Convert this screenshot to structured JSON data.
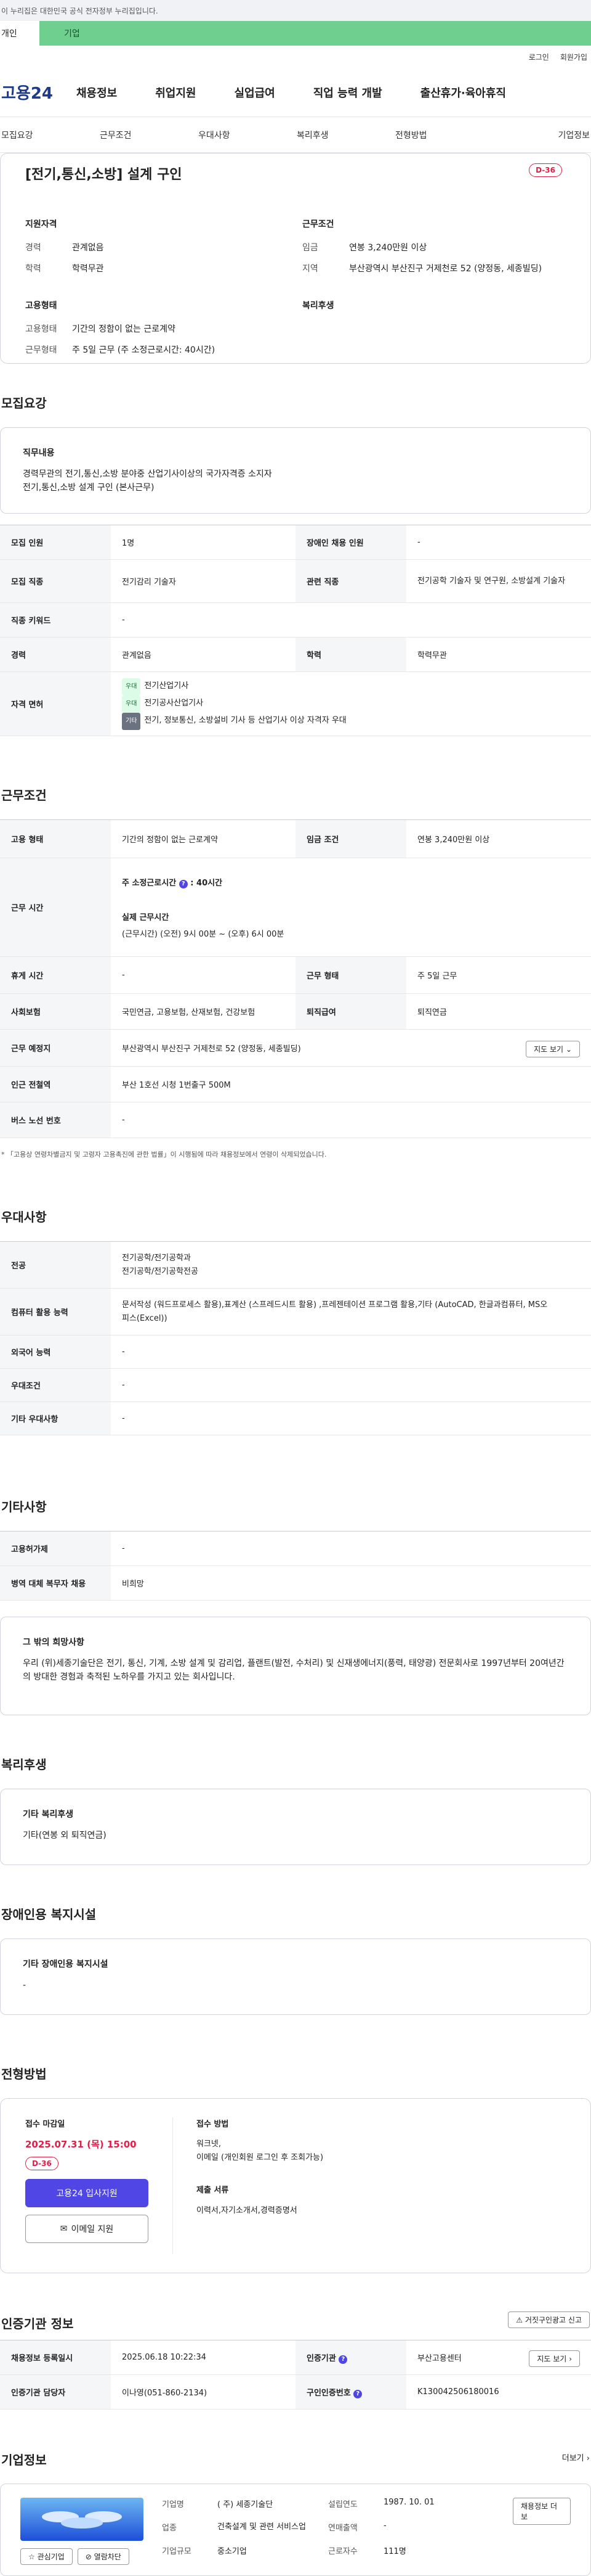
{
  "gov_banner": "이 누리집은 대한민국 공식 전자정부 누리집입니다.",
  "site_tabs": [
    "개인",
    "기업"
  ],
  "util": [
    "로그인",
    "회원가입"
  ],
  "logo": "고용24",
  "gnb": [
    "채용정보",
    "취업지원",
    "실업급여",
    "직업 능력 개발",
    "출산휴가·육아휴직"
  ],
  "subnav": [
    "모집요강",
    "근무조건",
    "우대사항",
    "복리후생",
    "전형방법",
    "기업정보"
  ],
  "hero": {
    "title": "[전기,통신,소방] 설계 구인",
    "dday": "D-36",
    "qual_title": "지원자격",
    "career_k": "경력",
    "career_v": "관계없음",
    "edu_k": "학력",
    "edu_v": "학력무관",
    "cond_title": "근무조건",
    "wage_k": "임금",
    "wage_v": "연봉 3,240만원 이상",
    "area_k": "지역",
    "area_v": "부산광역시 부산진구 거제천로 52 (양정동, 세종빌딩)",
    "emp_title": "고용형태",
    "emp_type_k": "고용형태",
    "emp_type_v": "기간의 정함이 없는 근로계약",
    "work_k": "근무형태",
    "work_v": "주 5일 근무 (주 소정근로시간: 40시간)",
    "welfare_title": "복리후생"
  },
  "recruit": {
    "title": "모집요강",
    "duty_title": "직무내용",
    "duty_lines": [
      "경력무관의 전기,통신,소방 분야중 산업기사이상의 국가자격증 소지자",
      "전기,통신,소방 설계 구인 (본사근무)"
    ],
    "rows": [
      {
        "k": "모집 인원",
        "v": "1명",
        "k2": "장애인 채용 인원",
        "v2": "-"
      },
      {
        "k": "모집 직종",
        "v": "전기감리 기술자",
        "k2": "관련 직종",
        "v2": "전기공학 기술자 및 연구원, 소방설계 기술자"
      },
      {
        "k": "직종 키워드",
        "v": "-"
      },
      {
        "k": "경력",
        "v": "관계없음",
        "k2": "학력",
        "v2": "학력무관"
      }
    ],
    "license_k": "자격 면허",
    "licenses": [
      {
        "tag": "우대",
        "name": "전기산업기사"
      },
      {
        "tag": "우대",
        "name": "전기공사산업기사"
      },
      {
        "tag": "기타",
        "name": "전기, 정보통신, 소방설비 기사 등 산업기사 이상 자격자 우대"
      }
    ]
  },
  "conditions": {
    "title": "근무조건",
    "emp_k": "고용 형태",
    "emp_v": "기간의 정함이 없는 근로계약",
    "wage_k": "임금 조건",
    "wage_v": "연봉 3,240만원 이상",
    "time_k": "근무 시간",
    "time_t1": "주 소정근로시간",
    "time_v1": "40시간",
    "time_t2": "실제 근무시간",
    "time_v2": "(근무시간) (오전) 9시 00분 ~ (오후) 6시 00분",
    "rest_k": "휴게 시간",
    "rest_v": "-",
    "type_k": "근무 형태",
    "type_v": "주 5일 근무",
    "ins_k": "사회보험",
    "ins_v": "국민연금, 고용보험, 산재보험, 건강보험",
    "ret_k": "퇴직급여",
    "ret_v": "퇴직연금",
    "place_k": "근무 예정지",
    "place_v": "부산광역시 부산진구 거제천로 52 (양정동, 세종빌딩)",
    "map_btn": "지도 보기",
    "sub_k": "인근 전철역",
    "sub_v": "부산 1호선 시청 1번출구 500M",
    "bus_k": "버스 노선 번호",
    "bus_v": "-",
    "note": "「고용상 연령차별금지 및 고령자 고용촉진에 관한 법률」이 시행됨에 따라 채용정보에서 연령이 삭제되었습니다."
  },
  "prefer": {
    "title": "우대사항",
    "major_k": "전공",
    "major_v": [
      "전기공학/전기공학과",
      "전기공학/전기공학전공"
    ],
    "pc_k": "컴퓨터 활용 능력",
    "pc_v": "문서작성 (워드프로세스 활용),표계산 (스프레드시트 활용) ,프레젠테이션 프로그램 활용,기타 (AutoCAD, 한글과컴퓨터, MS오피스(Excel))",
    "lang_k": "외국어 능력",
    "lang_v": "-",
    "cond_k": "우대조건",
    "cond_v": "-",
    "etc_k": "기타 우대사항",
    "etc_v": "-"
  },
  "etc": {
    "title": "기타사항",
    "k1": "고용허가제",
    "v1": "-",
    "k2": "병역 대체 복무자 채용",
    "v2": "비희망",
    "box_title": "그 밖의 희망사항",
    "box_text": "우리 (위)세종기술단은 전기, 통신, 기계, 소방 설계 및 감리업, 플랜트(발전, 수처리) 및 신재생에너지(풍력, 태양광) 전문회사로 1997년부터 20여년간의 방대한 경험과 축적된 노하우를 가지고 있는 회사입니다."
  },
  "welfare": {
    "title": "복리후생",
    "box_title": "기타 복리후생",
    "box_text": "기타(연봉 외 퇴직연금)"
  },
  "disab": {
    "title": "장애인용 복지시설",
    "box_title": "기타 장애인용 복지시설",
    "box_text": "-"
  },
  "process": {
    "title": "전형방법",
    "deadline_k": "접수 마감일",
    "deadline_v": "2025.07.31 (목) 15:00",
    "dday": "D-36",
    "apply_btn": "고용24 입사지원",
    "email_btn": "이메일 지원",
    "method_k": "접수 방법",
    "method_v": [
      "워크넷,",
      "이메일 (개인회원 로그인 후 조회가능)"
    ],
    "docs_k": "제출 서류",
    "docs_v": "이력서,자기소개서,경력증명서"
  },
  "cert": {
    "title": "인증기관 정보",
    "report_btn": "거짓구인광고 신고",
    "reg_k": "채용정보 등록일시",
    "reg_v": "2025.06.18 10:22:34",
    "org_k": "인증기관",
    "org_v": "부산고용센터",
    "map_btn": "지도 보기",
    "mgr_k": "인증기관 담당자",
    "mgr_v": "이나영(051-860-2134)",
    "num_k": "구인인증번호",
    "num_v": "K130042506180016"
  },
  "company": {
    "title": "기업정보",
    "more": "더보기",
    "interest_btn": "관심기업",
    "block_btn": "열람차단",
    "name_k": "기업명",
    "name_v": "( 주) 세종기술단",
    "found_k": "설립연도",
    "found_v": "1987. 10. 01",
    "jobs_btn": "채용정보 더보",
    "ind_k": "업종",
    "ind_v": "건축설계 및 관련 서비스업",
    "sales_k": "연매출액",
    "sales_v": "-",
    "emp_k": "근로자수",
    "emp_v": "111명",
    "size_k": "기업규모",
    "size_v": "중소기업"
  },
  "colors": {
    "brand": "#1e3a8a",
    "accent_tab": "#6fcf8f",
    "dday": "#e11d48",
    "primary_btn": "#4f46e5"
  }
}
